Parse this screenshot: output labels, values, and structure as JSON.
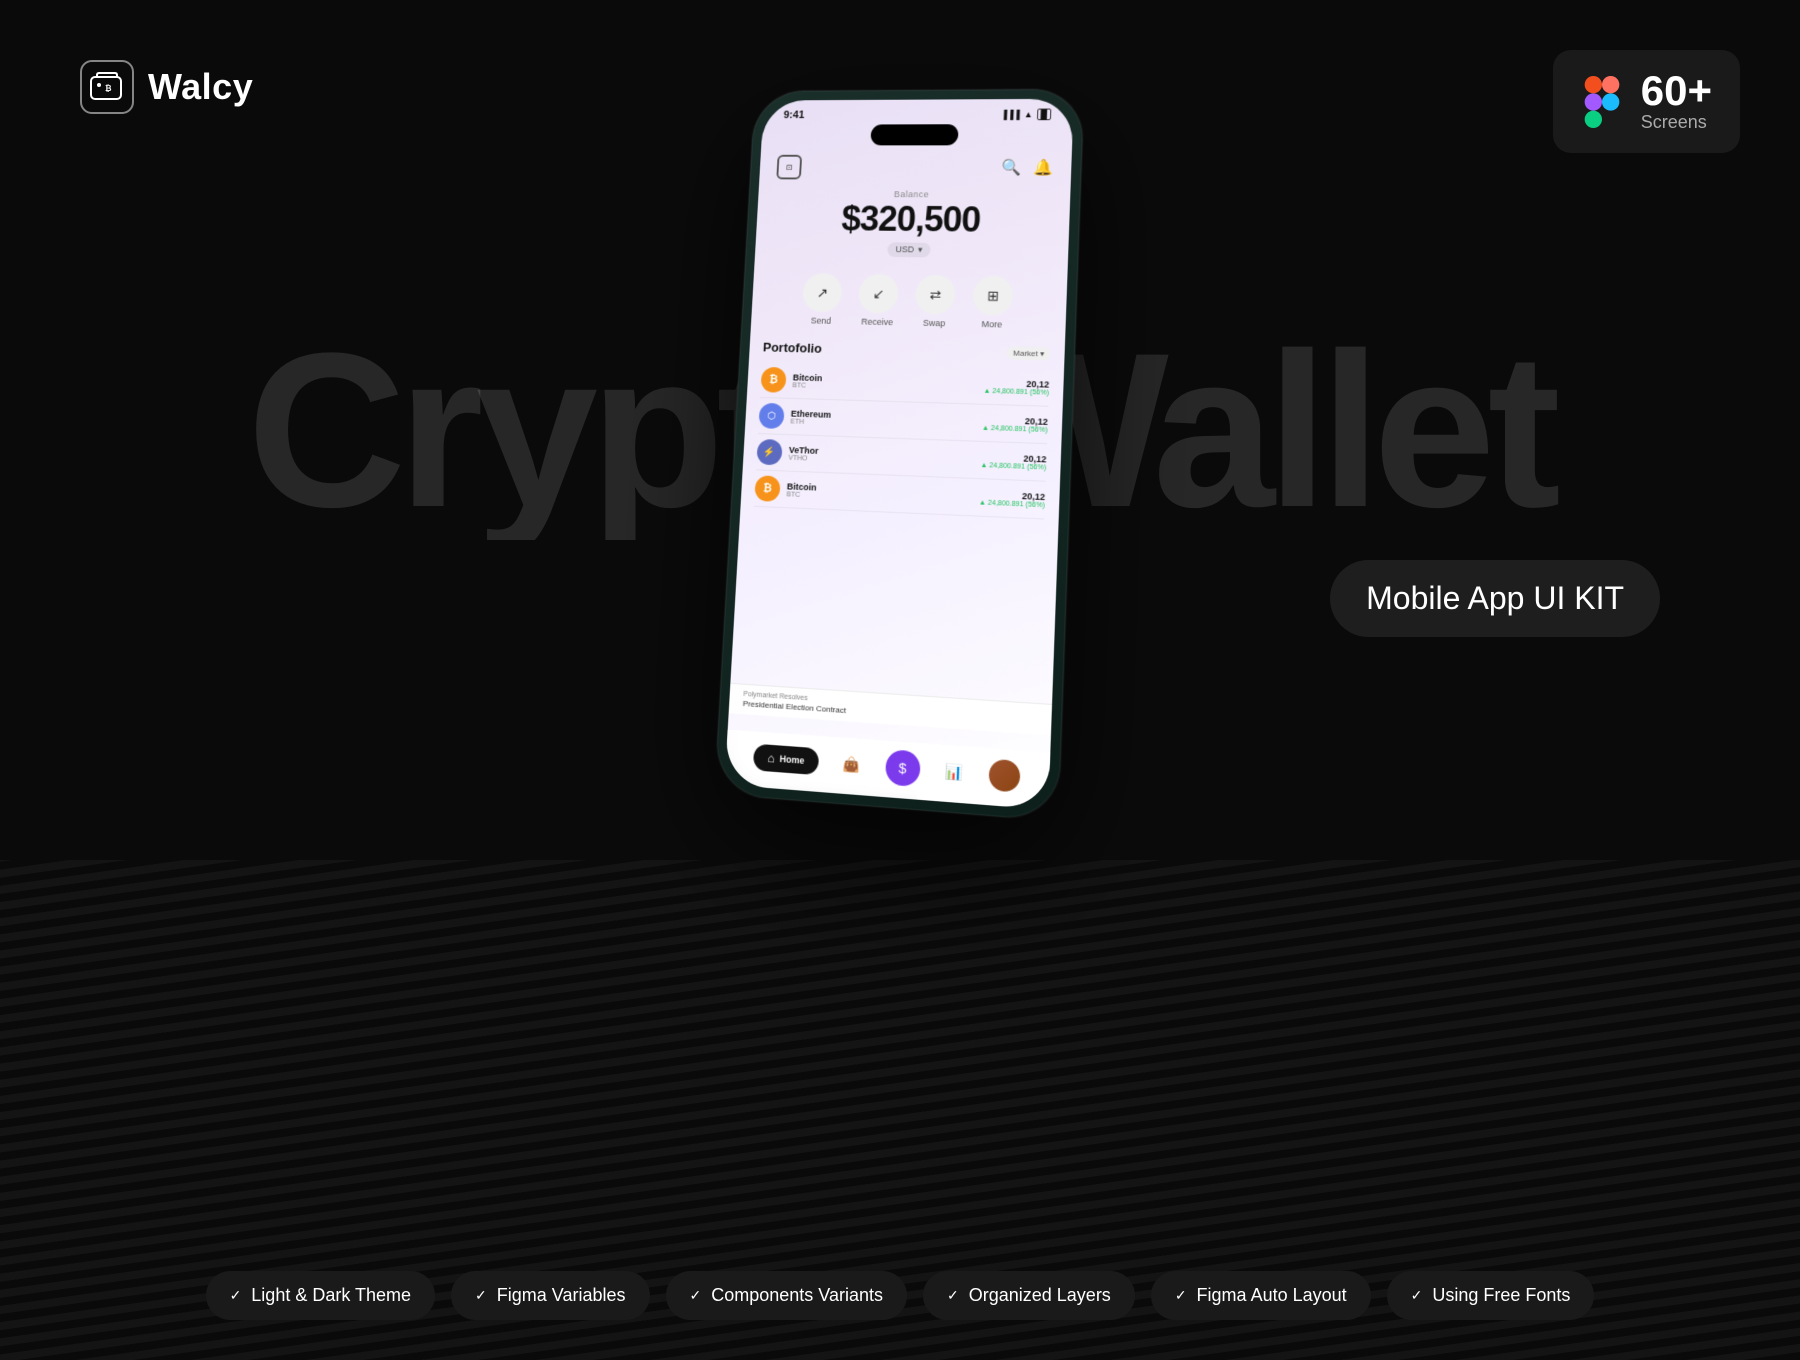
{
  "logo": {
    "name": "Walcy",
    "icon_label": "wallet-icon"
  },
  "figma_badge": {
    "count": "60+",
    "label": "Screens"
  },
  "hero_title": "Crypto Wallet",
  "uikit_badge": "Mobile App UI KIT",
  "phone": {
    "status_bar": {
      "time": "9:41",
      "signal": "●●●",
      "wifi": "WiFi",
      "battery": "Battery"
    },
    "balance": {
      "label": "Balance",
      "amount": "$320,500",
      "currency": "USD"
    },
    "actions": [
      {
        "label": "Send",
        "icon": "↗"
      },
      {
        "label": "Receive",
        "icon": "↙"
      },
      {
        "label": "Swap",
        "icon": "⇄"
      },
      {
        "label": "More",
        "icon": "⊞"
      }
    ],
    "portfolio": {
      "title": "Portofolio",
      "filter": "Market ▾",
      "items": [
        {
          "name": "Bitcoin",
          "ticker": "BTC",
          "amount": "20,12",
          "change": "▲ 24,800.891 (56%)",
          "color": "#f7931a"
        },
        {
          "name": "Ethereum",
          "ticker": "ETH",
          "amount": "20,12",
          "change": "▲ 24,800.891 (56%)",
          "color": "#627eea"
        },
        {
          "name": "VeThor",
          "ticker": "VTHO",
          "amount": "20,12",
          "change": "▲ 24,800.891 (56%)",
          "color": "#5c6bc0"
        },
        {
          "name": "Bitcoin",
          "ticker": "BTC",
          "amount": "20,12",
          "change": "▲ 24,800.891 (56%)",
          "color": "#f7931a"
        }
      ]
    },
    "news": {
      "source": "Polymarket Resolves",
      "headline": "Presidential Election Contract"
    }
  },
  "features": [
    {
      "label": "Light & Dark Theme",
      "check": "✓"
    },
    {
      "label": "Figma Variables",
      "check": "✓"
    },
    {
      "label": "Components Variants",
      "check": "✓"
    },
    {
      "label": "Organized Layers",
      "check": "✓"
    },
    {
      "label": "Figma Auto Layout",
      "check": "✓"
    },
    {
      "label": "Using Free Fonts",
      "check": "✓"
    }
  ]
}
